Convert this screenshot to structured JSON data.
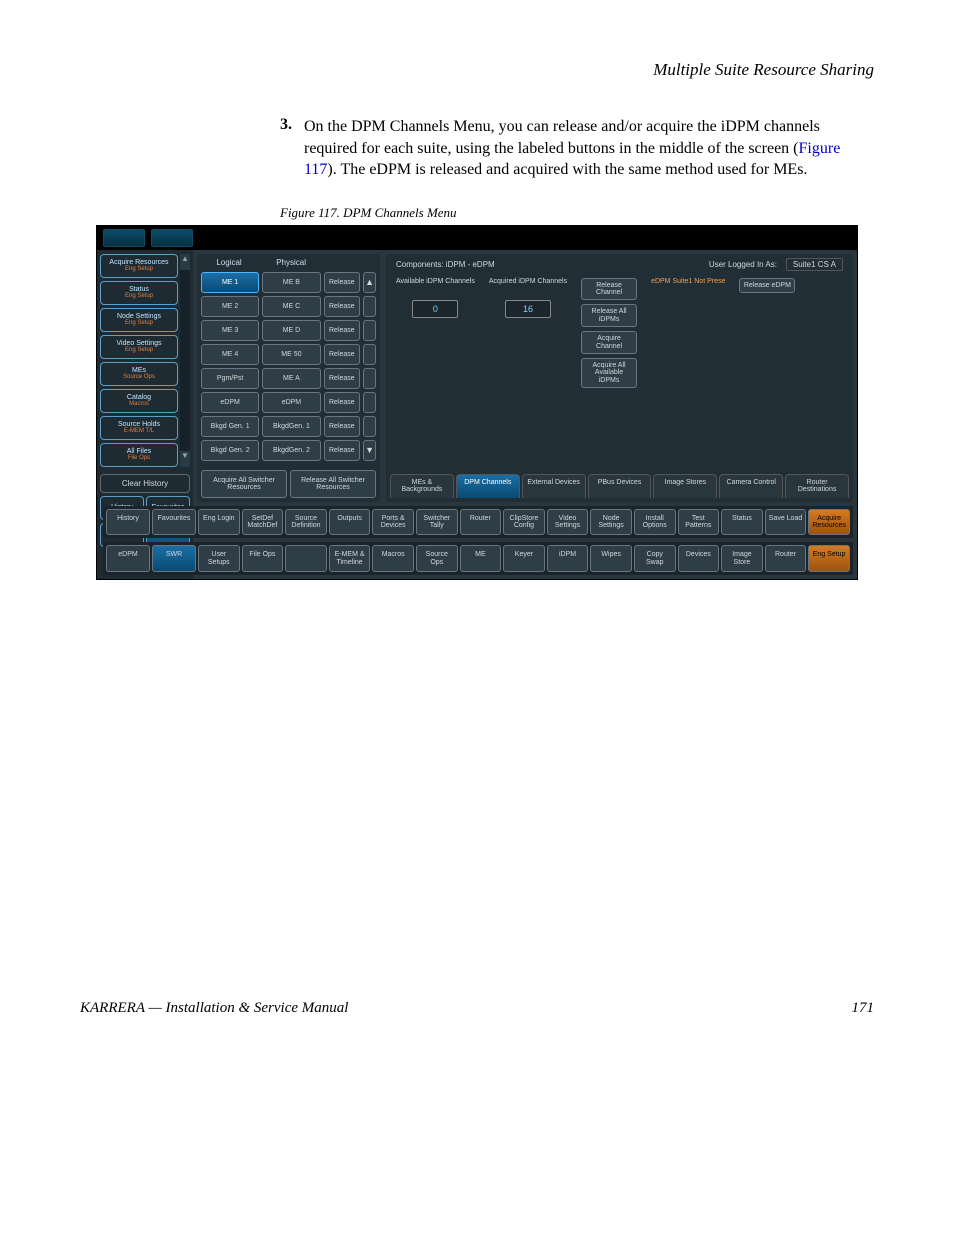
{
  "header": {
    "title": "Multiple Suite Resource Sharing"
  },
  "step": {
    "num": "3.",
    "text_a": "On the DPM Channels Menu, you can release and/or acquire the iDPM channels required for each suite, using the labeled buttons in the middle of the screen (",
    "link": "Figure 117",
    "text_b": "). The eDPM is released and acquired with the same method used for MEs."
  },
  "figure_caption": "Figure 117.  DPM Channels Menu",
  "sidebar": {
    "items": [
      {
        "label": "Acquire Resources",
        "sub": "Eng Setup"
      },
      {
        "label": "Status",
        "sub": "Eng Setup"
      },
      {
        "label": "Node Settings",
        "sub": "Eng Setup"
      },
      {
        "label": "Video Settings",
        "sub": "Eng Setup"
      },
      {
        "label": "MEs",
        "sub": "Source Ops"
      },
      {
        "label": "Catalog",
        "sub": "Macros"
      },
      {
        "label": "Source Holds",
        "sub": "E-MEM T/L"
      },
      {
        "label": "All Files",
        "sub": "File Ops"
      }
    ],
    "history": "History",
    "favourites": "Favourites",
    "clear": "Clear History",
    "edpm": "eDPM",
    "swr": "SWR"
  },
  "left_panel": {
    "hd_logical": "Logical",
    "hd_physical": "Physical",
    "rows": [
      [
        "ME 1",
        "ME B",
        "Release"
      ],
      [
        "ME 2",
        "ME C",
        "Release"
      ],
      [
        "ME 3",
        "ME D",
        "Release"
      ],
      [
        "ME 4",
        "ME 50",
        "Release"
      ],
      [
        "Pgm/Pst",
        "ME A",
        "Release"
      ],
      [
        "eDPM",
        "eDPM",
        "Release"
      ],
      [
        "Bkgd Gen. 1",
        "BkgdGen. 1",
        "Release"
      ],
      [
        "Bkgd Gen. 2",
        "BkgdGen. 2",
        "Release"
      ]
    ],
    "acquire_all": "Acquire All Switcher Resources",
    "release_all": "Release All Switcher Resources"
  },
  "right_panel": {
    "components_label": "Components: iDPM - eDPM",
    "user_label": "User Logged In As:",
    "user_value": "Suite1  CS A",
    "avail_label": "Available iDPM Channels",
    "avail_val": "0",
    "acq_label": "Acquired iDPM Channels",
    "acq_val": "16",
    "release_channel": "Release Channel",
    "release_all_idpm": "Release All iDPMs",
    "acquire_channel": "Acquire Channel",
    "acquire_all_idpm": "Acquire All Available iDPMs",
    "edpm_status": "eDPM Suite1 Not Prese",
    "release_edpm": "Release eDPM",
    "tabs": [
      "MEs & Backgrounds",
      "DPM Channels",
      "External Devices",
      "PBus Devices",
      "Image Stores",
      "Camera Control",
      "Router Destinations"
    ]
  },
  "menu1": [
    "Eng Login",
    "SetDef MatchDef",
    "Source Definition",
    "Outputs",
    "Ports & Devices",
    "Switcher Tally",
    "Router",
    "ClipStore Config",
    "Video Settings",
    "Node Settings",
    "Install Options",
    "Test Patterns",
    "Status",
    "Save Load",
    "Acquire Resources"
  ],
  "menu2": [
    "User Setups",
    "File Ops",
    "",
    "E-MEM & Timeline",
    "Macros",
    "Source Ops",
    "ME",
    "Keyer",
    "iDPM",
    "Wipes",
    "Copy Swap",
    "Devices",
    "Image Store",
    "Router",
    "Eng Setup"
  ],
  "footer": {
    "left": "KARRERA  —  Installation & Service Manual",
    "right": "171"
  }
}
